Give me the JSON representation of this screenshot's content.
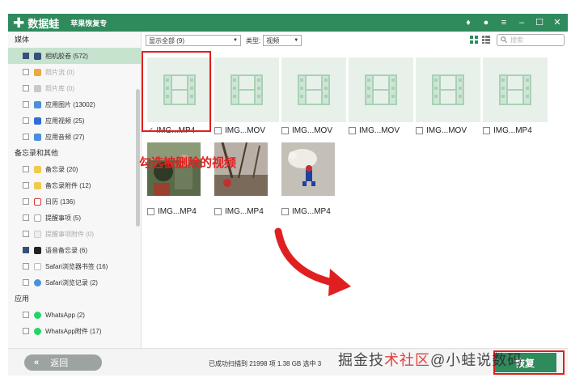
{
  "app": {
    "name": "数据蛙",
    "subtitle": "苹果恢复专"
  },
  "sidebar": {
    "groups": [
      {
        "title": "媒体",
        "items": [
          {
            "label": "相机胶卷 (572)",
            "state": "filled",
            "active": true,
            "icon": "camera-roll-icon"
          },
          {
            "label": "照片流 (0)",
            "state": "none",
            "dim": true,
            "icon": "photo-stream-icon"
          },
          {
            "label": "照片库 (0)",
            "state": "none",
            "dim": true,
            "icon": "photo-library-icon"
          },
          {
            "label": "应用图片 (13002)",
            "state": "none",
            "icon": "app-images-icon"
          },
          {
            "label": "应用视频 (25)",
            "state": "none",
            "icon": "app-videos-icon"
          },
          {
            "label": "应用音频 (27)",
            "state": "none",
            "icon": "app-audio-icon"
          }
        ]
      },
      {
        "title": "备忘录和其他",
        "items": [
          {
            "label": "备忘录 (20)",
            "state": "none",
            "icon": "notes-icon"
          },
          {
            "label": "备忘录附件 (12)",
            "state": "none",
            "icon": "notes-attachment-icon"
          },
          {
            "label": "日历 (136)",
            "state": "none",
            "icon": "calendar-icon"
          },
          {
            "label": "提醒事项 (5)",
            "state": "none",
            "icon": "reminders-icon"
          },
          {
            "label": "提醒事项附件 (0)",
            "state": "none",
            "dim": true,
            "icon": "reminders-attachment-icon"
          },
          {
            "label": "语音备忘录 (6)",
            "state": "filled",
            "icon": "voice-memo-icon"
          },
          {
            "label": "Safari浏览器书签 (16)",
            "state": "none",
            "icon": "safari-bookmark-icon"
          },
          {
            "label": "Safari浏览记录 (2)",
            "state": "none",
            "icon": "safari-history-icon"
          }
        ]
      },
      {
        "title": "应用",
        "items": [
          {
            "label": "WhatsApp (2)",
            "state": "none",
            "icon": "whatsapp-icon"
          },
          {
            "label": "WhatsApp附件 (17)",
            "state": "none",
            "icon": "whatsapp-attachment-icon"
          }
        ]
      }
    ]
  },
  "toolbar": {
    "filter_value": "显示全部 (9)",
    "type_label": "类型:",
    "type_value": "视频",
    "search_placeholder": "搜索"
  },
  "files": [
    {
      "name": "IMG...MP4",
      "checked": true,
      "kind": "video"
    },
    {
      "name": "IMG...MOV",
      "checked": false,
      "kind": "video"
    },
    {
      "name": "IMG...MOV",
      "checked": false,
      "kind": "video"
    },
    {
      "name": "IMG...MOV",
      "checked": false,
      "kind": "video"
    },
    {
      "name": "IMG...MOV",
      "checked": false,
      "kind": "video"
    },
    {
      "name": "IMG...MP4",
      "checked": false,
      "kind": "video"
    },
    {
      "name": "IMG...MP4",
      "checked": false,
      "kind": "photo"
    },
    {
      "name": "IMG...MP4",
      "checked": false,
      "kind": "photo"
    },
    {
      "name": "IMG...MP4",
      "checked": false,
      "kind": "photo"
    }
  ],
  "annotation": "勾选被删除的视频",
  "footer": {
    "back_label": "返回",
    "status": "已成功扫描到 21998 项 1.38 GB  选中 3",
    "recover_label": "恢复"
  },
  "watermark": {
    "part1": "掘金技",
    "part2": "术社区",
    "part3": "@小蛙说数码"
  },
  "colors": {
    "brand_green": "#2f8a5c",
    "annotation_red": "#e02020",
    "thumb_bg": "#e7f1ea"
  }
}
